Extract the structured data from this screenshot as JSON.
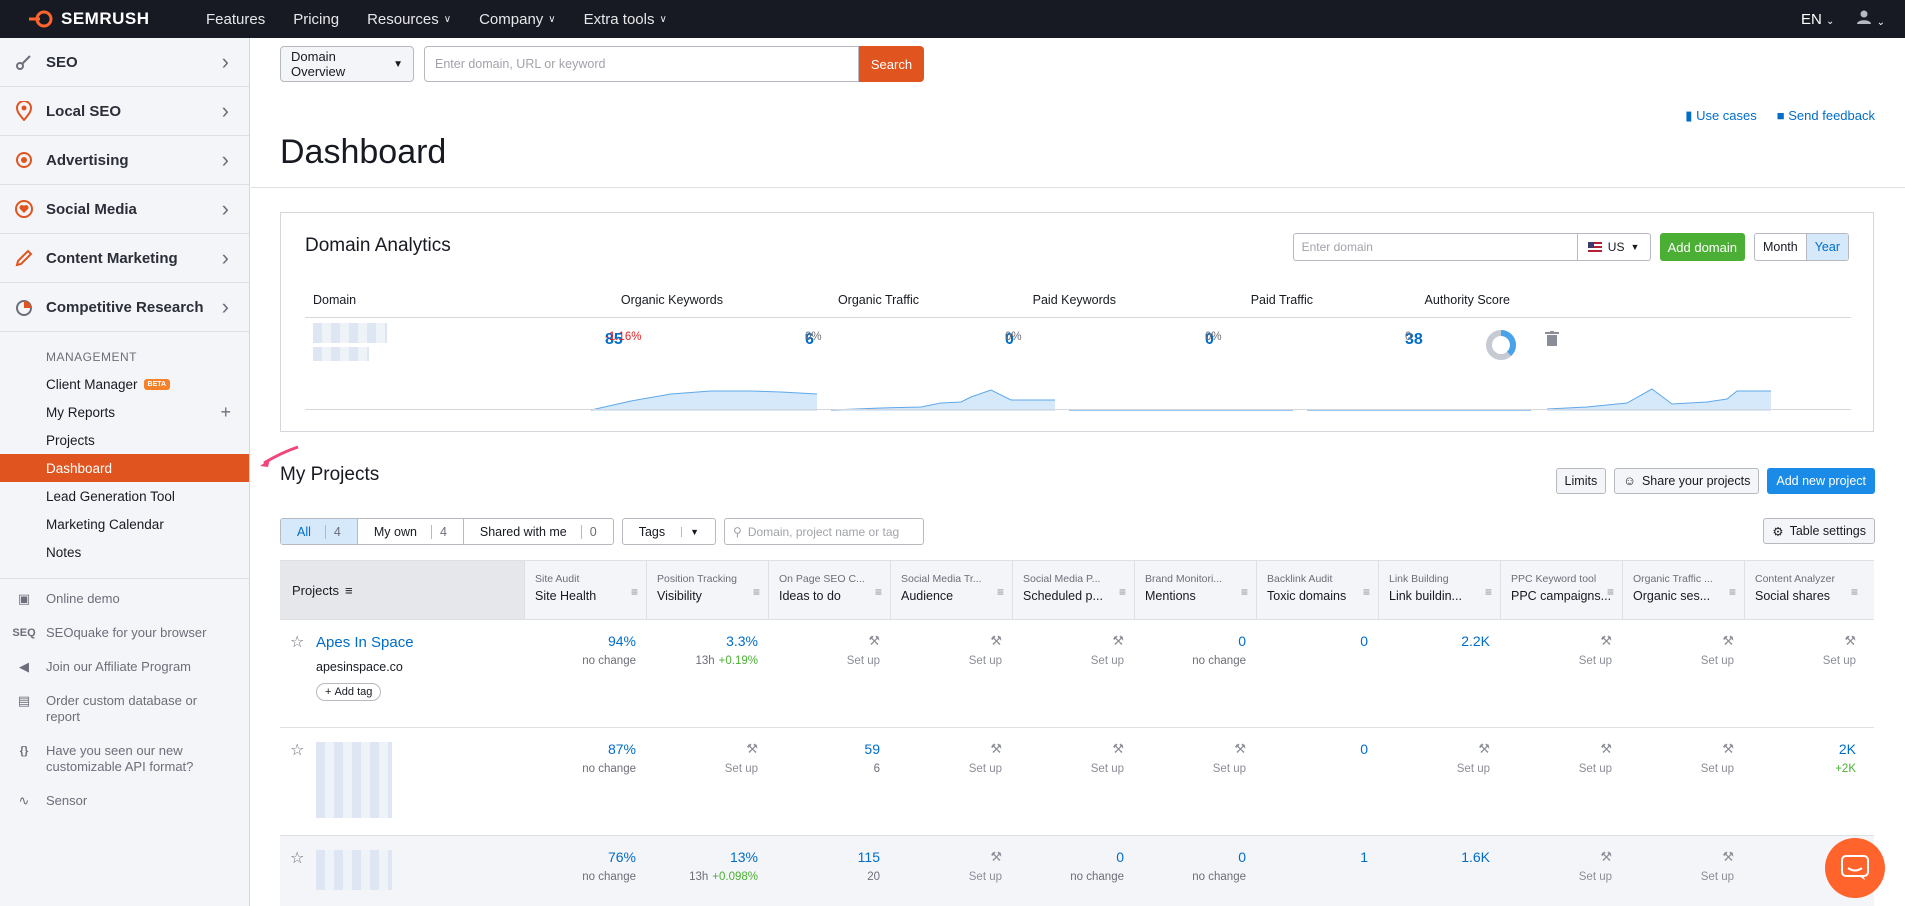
{
  "topnav": {
    "brand": "SEMRUSH",
    "items": [
      {
        "label": "Features",
        "chev": false
      },
      {
        "label": "Pricing",
        "chev": false
      },
      {
        "label": "Resources",
        "chev": true
      },
      {
        "label": "Company",
        "chev": true
      },
      {
        "label": "Extra tools",
        "chev": true
      }
    ],
    "lang": "EN"
  },
  "sidebar": {
    "sections": [
      {
        "label": "SEO",
        "icon": "seo-icon"
      },
      {
        "label": "Local SEO",
        "icon": "location-icon"
      },
      {
        "label": "Advertising",
        "icon": "target-icon"
      },
      {
        "label": "Social Media",
        "icon": "heart-icon"
      },
      {
        "label": "Content Marketing",
        "icon": "pen-icon"
      },
      {
        "label": "Competitive Research",
        "icon": "chart-icon"
      }
    ],
    "management_title": "MANAGEMENT",
    "management": [
      {
        "label": "Client Manager",
        "badge": "BETA"
      },
      {
        "label": "My Reports",
        "plus": true
      },
      {
        "label": "Projects"
      },
      {
        "label": "Dashboard",
        "active": true
      },
      {
        "label": "Lead Generation Tool"
      },
      {
        "label": "Marketing Calendar"
      },
      {
        "label": "Notes"
      }
    ],
    "extra": [
      {
        "label": "Online demo",
        "icon": "monitor-icon"
      },
      {
        "label": "SEOquake for your browser",
        "icon": "seoquake-icon",
        "glyph": "SEQ"
      },
      {
        "label": "Join our Affiliate Program",
        "icon": "megaphone-icon"
      },
      {
        "label": "Order custom database or report",
        "icon": "document-icon"
      },
      {
        "label": "Have you seen our new customizable API format?",
        "icon": "braces-icon",
        "glyph": "{}"
      },
      {
        "label": "Sensor",
        "icon": "pulse-icon"
      }
    ]
  },
  "search": {
    "dropdown": "Domain Overview",
    "placeholder": "Enter domain, URL or keyword",
    "button": "Search"
  },
  "links": {
    "use_cases": "Use cases",
    "feedback": "Send feedback"
  },
  "page_title": "Dashboard",
  "domain_analytics": {
    "title": "Domain Analytics",
    "input_placeholder": "Enter domain",
    "country": "US",
    "add_button": "Add domain",
    "period": [
      "Month",
      "Year"
    ],
    "columns": [
      "Domain",
      "Organic Keywords",
      "Organic Traffic",
      "Paid Keywords",
      "Paid Traffic",
      "Authority Score"
    ],
    "values": {
      "organic_keywords": "85",
      "organic_keywords_change": "-1.16%",
      "organic_traffic": "6",
      "organic_traffic_change": "0%",
      "paid_keywords": "0",
      "paid_keywords_change": "0%",
      "paid_traffic": "0",
      "paid_traffic_change": "0%",
      "authority_score": "38",
      "authority_score_change": "0"
    }
  },
  "projects": {
    "title": "My Projects",
    "buttons": {
      "limits": "Limits",
      "share": "Share your projects",
      "add": "Add new project",
      "settings": "Table settings"
    },
    "filters": {
      "all": "All",
      "all_count": "4",
      "own": "My own",
      "own_count": "4",
      "shared": "Shared with me",
      "shared_count": "0",
      "tags": "Tags"
    },
    "search_placeholder": "Domain, project name or tag",
    "header_projects": "Projects",
    "columns": [
      {
        "tool": "Site Audit",
        "metric": "Site Health"
      },
      {
        "tool": "Position Tracking",
        "metric": "Visibility"
      },
      {
        "tool": "On Page SEO C...",
        "metric": "Ideas to do"
      },
      {
        "tool": "Social Media Tr...",
        "metric": "Audience"
      },
      {
        "tool": "Social Media P...",
        "metric": "Scheduled p..."
      },
      {
        "tool": "Brand Monitori...",
        "metric": "Mentions"
      },
      {
        "tool": "Backlink Audit",
        "metric": "Toxic domains"
      },
      {
        "tool": "Link Building",
        "metric": "Link buildin..."
      },
      {
        "tool": "PPC Keyword tool",
        "metric": "PPC campaigns..."
      },
      {
        "tool": "Organic Traffic ...",
        "metric": "Organic ses..."
      },
      {
        "tool": "Content Analyzer",
        "metric": "Social shares"
      }
    ],
    "setup_label": "Set up",
    "rows": [
      {
        "name": "Apes In Space",
        "domain": "apesinspace.co",
        "add_tag": "Add tag",
        "cells": [
          {
            "v": "94%",
            "s": "no change"
          },
          {
            "v": "3.3%",
            "s": "13h",
            "g": "+0.19%"
          },
          {
            "setup": true
          },
          {
            "setup": true
          },
          {
            "setup": true
          },
          {
            "v": "0",
            "s": "no change"
          },
          {
            "v": "0",
            "s": ""
          },
          {
            "v": "2.2K",
            "s": ""
          },
          {
            "setup": true
          },
          {
            "setup": true
          },
          {
            "setup": true
          }
        ]
      },
      {
        "name": "",
        "domain": "",
        "add_tag": "",
        "cells": [
          {
            "v": "87%",
            "s": "no change"
          },
          {
            "setup": true
          },
          {
            "v": "59",
            "s": "6"
          },
          {
            "setup": true
          },
          {
            "setup": true
          },
          {
            "setup": true
          },
          {
            "v": "0",
            "s": ""
          },
          {
            "setup": true
          },
          {
            "setup": true
          },
          {
            "setup": true
          },
          {
            "v": "2K",
            "s": "",
            "g": "+2K"
          }
        ]
      },
      {
        "name": "",
        "domain": "",
        "add_tag": "",
        "cells": [
          {
            "v": "76%",
            "s": "no change"
          },
          {
            "v": "13%",
            "s": "13h",
            "g": "+0.098%"
          },
          {
            "v": "115",
            "s": "20"
          },
          {
            "setup": true
          },
          {
            "v": "0",
            "s": "no change"
          },
          {
            "v": "0",
            "s": "no change"
          },
          {
            "v": "1",
            "s": ""
          },
          {
            "v": "1.6K",
            "s": ""
          },
          {
            "setup": true
          },
          {
            "setup": true
          },
          {
            "setup": false
          }
        ]
      }
    ]
  },
  "colors": {
    "brand_orange": "#e0541f",
    "link_blue": "#006dca",
    "green": "#4caf35",
    "dark": "#171a22"
  }
}
